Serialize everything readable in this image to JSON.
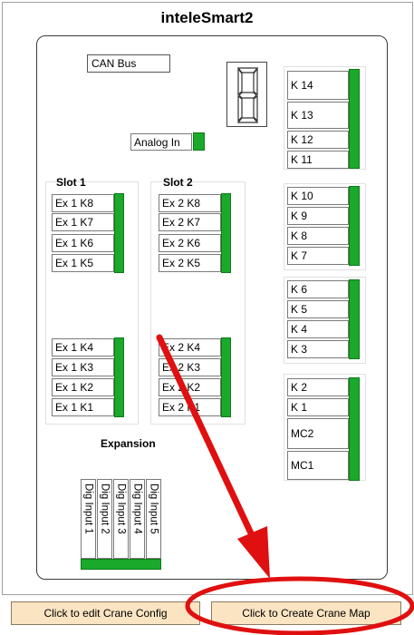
{
  "title": "inteleSmart2",
  "can_bus_label": "CAN Bus",
  "analog_in_label": "Analog In",
  "digit_display": "8",
  "slot1": {
    "label": "Slot 1",
    "top": [
      "Ex 1 K8",
      "Ex 1 K7",
      "Ex 1 K6",
      "Ex 1 K5"
    ],
    "bottom": [
      "Ex 1 K4",
      "Ex 1 K3",
      "Ex 1 K2",
      "Ex 1 K1"
    ]
  },
  "slot2": {
    "label": "Slot 2",
    "top": [
      "Ex 2 K8",
      "Ex 2 K7",
      "Ex 2 K6",
      "Ex 2 K5"
    ],
    "bottom": [
      "Ex 2 K4",
      "Ex 2 K3",
      "Ex 2 K2",
      "Ex 2 K1"
    ]
  },
  "expansion_label": "Expansion",
  "relays": {
    "group1": [
      "K 14",
      "K 13",
      "K 12",
      "K 11"
    ],
    "group2": [
      "K 10",
      "K 9",
      "K 8",
      "K 7"
    ],
    "group3": [
      "K 6",
      "K 5",
      "K 4",
      "K 3"
    ],
    "group4": [
      "K 2",
      "K 1",
      "MC2",
      "MC1"
    ]
  },
  "dig_inputs": [
    "Dig Input 1",
    "Dig Input 2",
    "Dig Input 3",
    "Dig Input 4",
    "Dig Input 5"
  ],
  "buttons": {
    "edit_config": "Click to edit Crane Config",
    "create_map": "Click to Create Crane Map"
  },
  "colors": {
    "led_green": "#1aa92a",
    "button_bg": "#fbe4c2",
    "annotation_red": "#e01010"
  }
}
